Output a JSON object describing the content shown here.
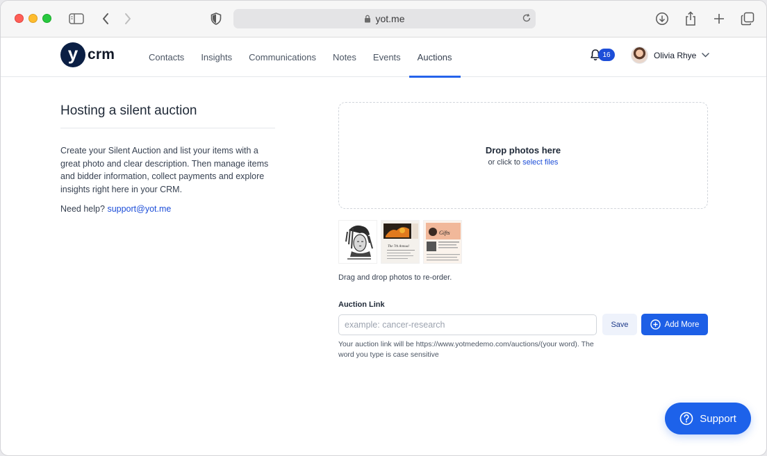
{
  "browser": {
    "url": "yot.me"
  },
  "app": {
    "logo_letter": "y",
    "logo_text": "crm",
    "nav": [
      {
        "label": "Contacts"
      },
      {
        "label": "Insights"
      },
      {
        "label": "Communications"
      },
      {
        "label": "Notes"
      },
      {
        "label": "Events"
      },
      {
        "label": "Auctions",
        "active": true
      }
    ],
    "notifications_count": "16",
    "user_name": "Olivia Rhye"
  },
  "left": {
    "title": "Hosting a silent auction",
    "description": "Create your Silent Auction and list your items with a great photo and clear description. Then manage items and bidder information, collect payments and explore insights right here in your CRM.",
    "help_prefix": "Need help?",
    "help_email": "support@yot.me"
  },
  "dropzone": {
    "title": "Drop photos here",
    "subtitle_prefix": "or click to",
    "subtitle_link": "select files"
  },
  "reorder_text": "Drag and drop photos to re-order.",
  "auction_link": {
    "label": "Auction Link",
    "placeholder": "example: cancer-research",
    "value": "",
    "save_label": "Save",
    "add_more_label": "Add More",
    "hint": "Your auction link will be https://www.yotmedemo.com/auctions/(your word). The word you type is case sensitive"
  },
  "support_label": "Support",
  "colors": {
    "brand_navy": "#0b1f44",
    "primary": "#1d5fe6",
    "link": "#1d4ed8",
    "active_tab": "#2563eb"
  }
}
